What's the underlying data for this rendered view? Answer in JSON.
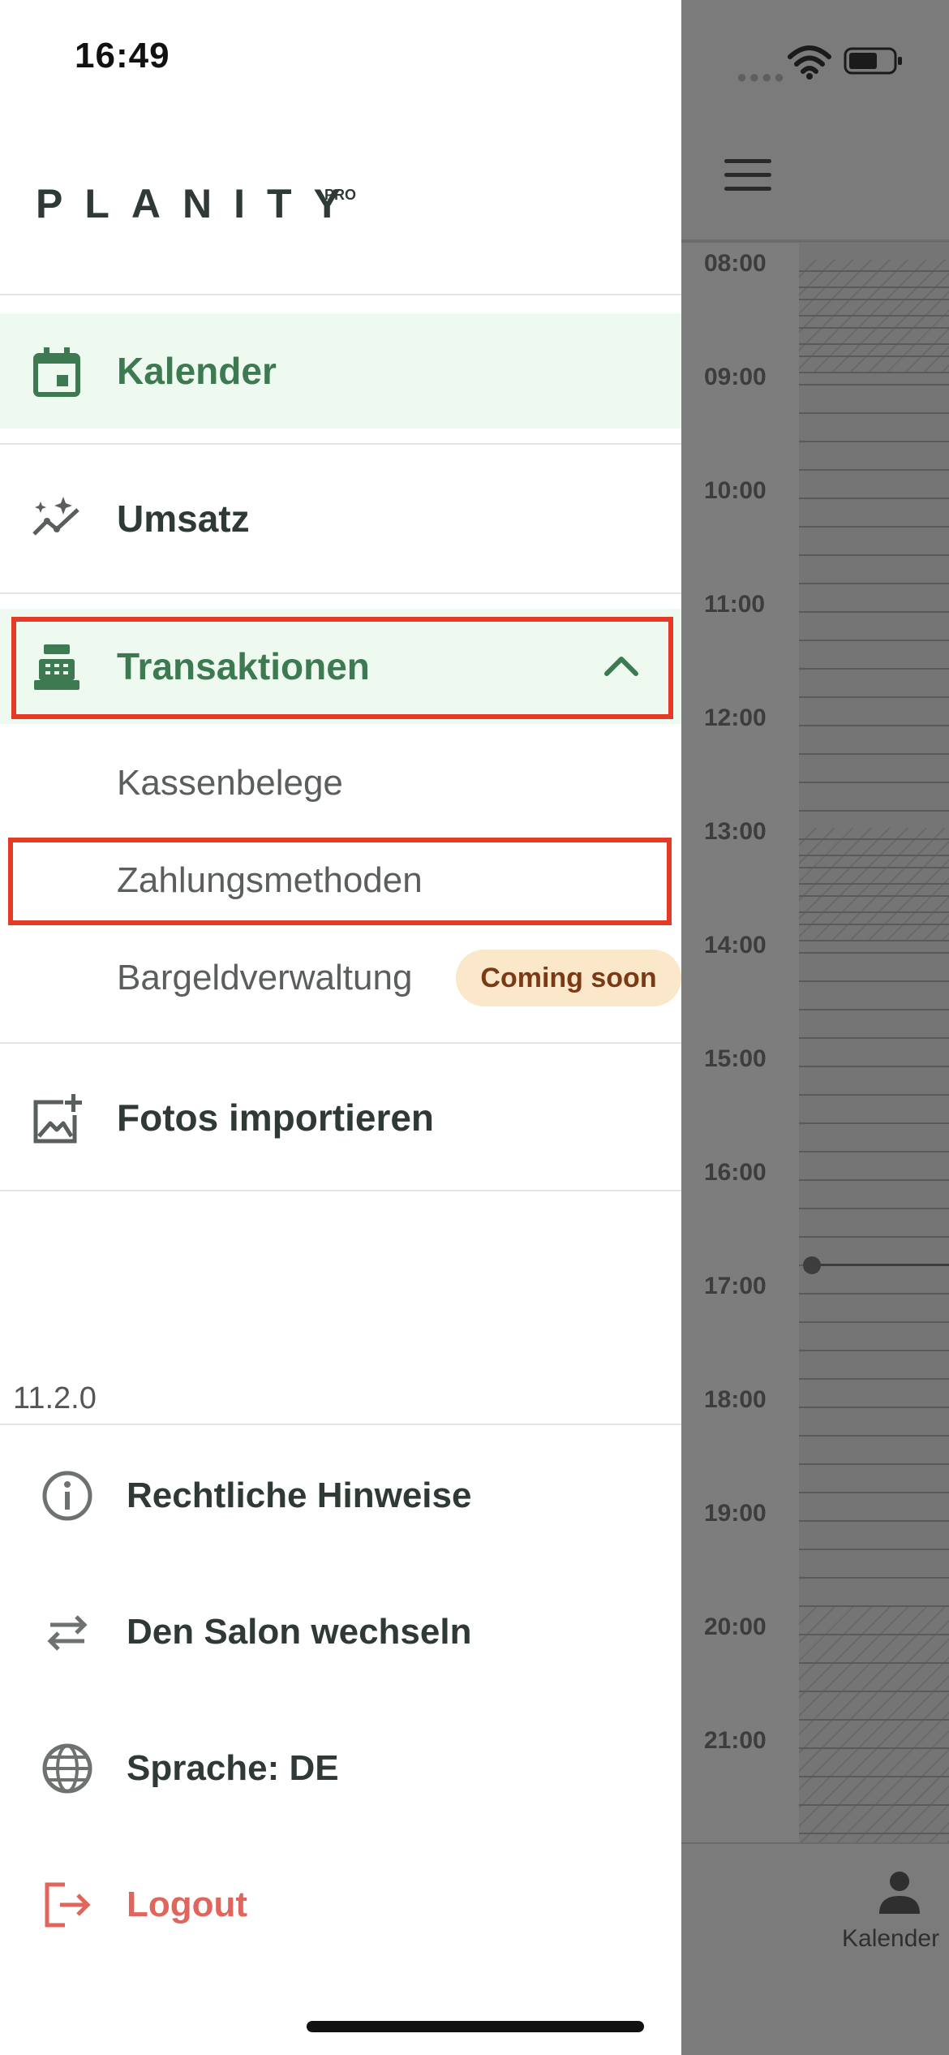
{
  "status_bar": {
    "time": "16:49"
  },
  "logo": {
    "name": "PLANITY",
    "suffix": "PRO"
  },
  "nav": {
    "kalender": "Kalender",
    "umsatz": "Umsatz",
    "transaktionen": "Transaktionen",
    "sub_items": [
      "Kassenbelege",
      "Zahlungsmethoden",
      "Bargeldverwaltung"
    ],
    "coming_soon": "Coming soon",
    "fotos": "Fotos importieren"
  },
  "version": "11.2.0",
  "footer": {
    "legal": "Rechtliche Hinweise",
    "switch_salon": "Den Salon wechseln",
    "language": "Sprache: DE",
    "logout": "Logout"
  },
  "calendar": {
    "times": [
      "08:00",
      "09:00",
      "10:00",
      "11:00",
      "12:00",
      "13:00",
      "14:00",
      "15:00",
      "16:00",
      "17:00",
      "18:00",
      "19:00",
      "20:00",
      "21:00"
    ],
    "tab_label": "Kalender"
  },
  "colors": {
    "accent_green": "#3d7a51",
    "active_bg": "#eefaef",
    "highlight_red": "#e53a25",
    "logout_red": "#e0655c",
    "badge_bg": "#fbe7c9"
  }
}
